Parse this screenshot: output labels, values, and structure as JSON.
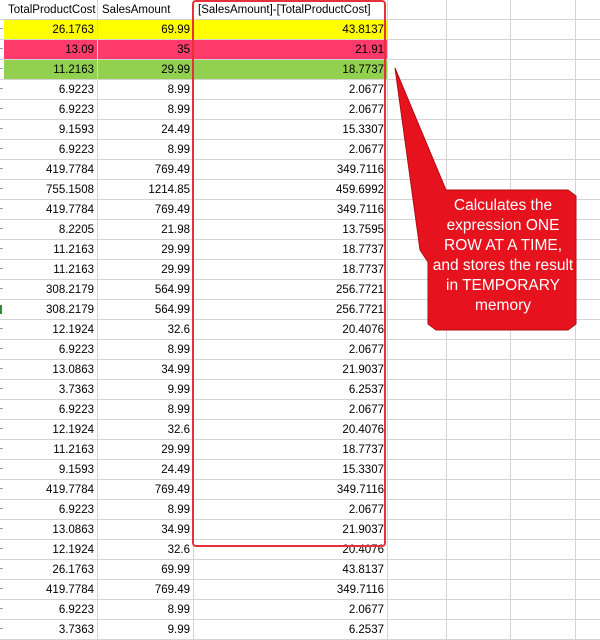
{
  "headers": [
    "TotalProductCost",
    "SalesAmount",
    "[SalesAmount]-[TotalProductCost]"
  ],
  "rows": [
    [
      "26.1763",
      "69.99",
      "43.8137"
    ],
    [
      "13.09",
      "35",
      "21.91"
    ],
    [
      "11.2163",
      "29.99",
      "18.7737"
    ],
    [
      "6.9223",
      "8.99",
      "2.0677"
    ],
    [
      "6.9223",
      "8.99",
      "2.0677"
    ],
    [
      "9.1593",
      "24.49",
      "15.3307"
    ],
    [
      "6.9223",
      "8.99",
      "2.0677"
    ],
    [
      "419.7784",
      "769.49",
      "349.7116"
    ],
    [
      "755.1508",
      "1214.85",
      "459.6992"
    ],
    [
      "419.7784",
      "769.49",
      "349.7116"
    ],
    [
      "8.2205",
      "21.98",
      "13.7595"
    ],
    [
      "11.2163",
      "29.99",
      "18.7737"
    ],
    [
      "11.2163",
      "29.99",
      "18.7737"
    ],
    [
      "308.2179",
      "564.99",
      "256.7721"
    ],
    [
      "308.2179",
      "564.99",
      "256.7721"
    ],
    [
      "12.1924",
      "32.6",
      "20.4076"
    ],
    [
      "6.9223",
      "8.99",
      "2.0677"
    ],
    [
      "13.0863",
      "34.99",
      "21.9037"
    ],
    [
      "3.7363",
      "9.99",
      "6.2537"
    ],
    [
      "6.9223",
      "8.99",
      "2.0677"
    ],
    [
      "12.1924",
      "32.6",
      "20.4076"
    ],
    [
      "11.2163",
      "29.99",
      "18.7737"
    ],
    [
      "9.1593",
      "24.49",
      "15.3307"
    ],
    [
      "419.7784",
      "769.49",
      "349.7116"
    ],
    [
      "6.9223",
      "8.99",
      "2.0677"
    ],
    [
      "13.0863",
      "34.99",
      "21.9037"
    ],
    [
      "12.1924",
      "32.6",
      "20.4076"
    ],
    [
      "26.1763",
      "69.99",
      "43.8137"
    ],
    [
      "419.7784",
      "769.49",
      "349.7116"
    ],
    [
      "6.9223",
      "8.99",
      "2.0677"
    ],
    [
      "3.7363",
      "9.99",
      "6.2537"
    ]
  ],
  "highlight_colors": [
    "#ffff00",
    "#ff3b6b",
    "#92d050"
  ],
  "colors": {
    "callout": "#e6121e",
    "frame": "#e6313a",
    "gridline": "#d4d4d4"
  },
  "callout": {
    "text": "Calculates the expression ONE ROW AT A TIME, and stores the result in TEMPORARY memory"
  }
}
